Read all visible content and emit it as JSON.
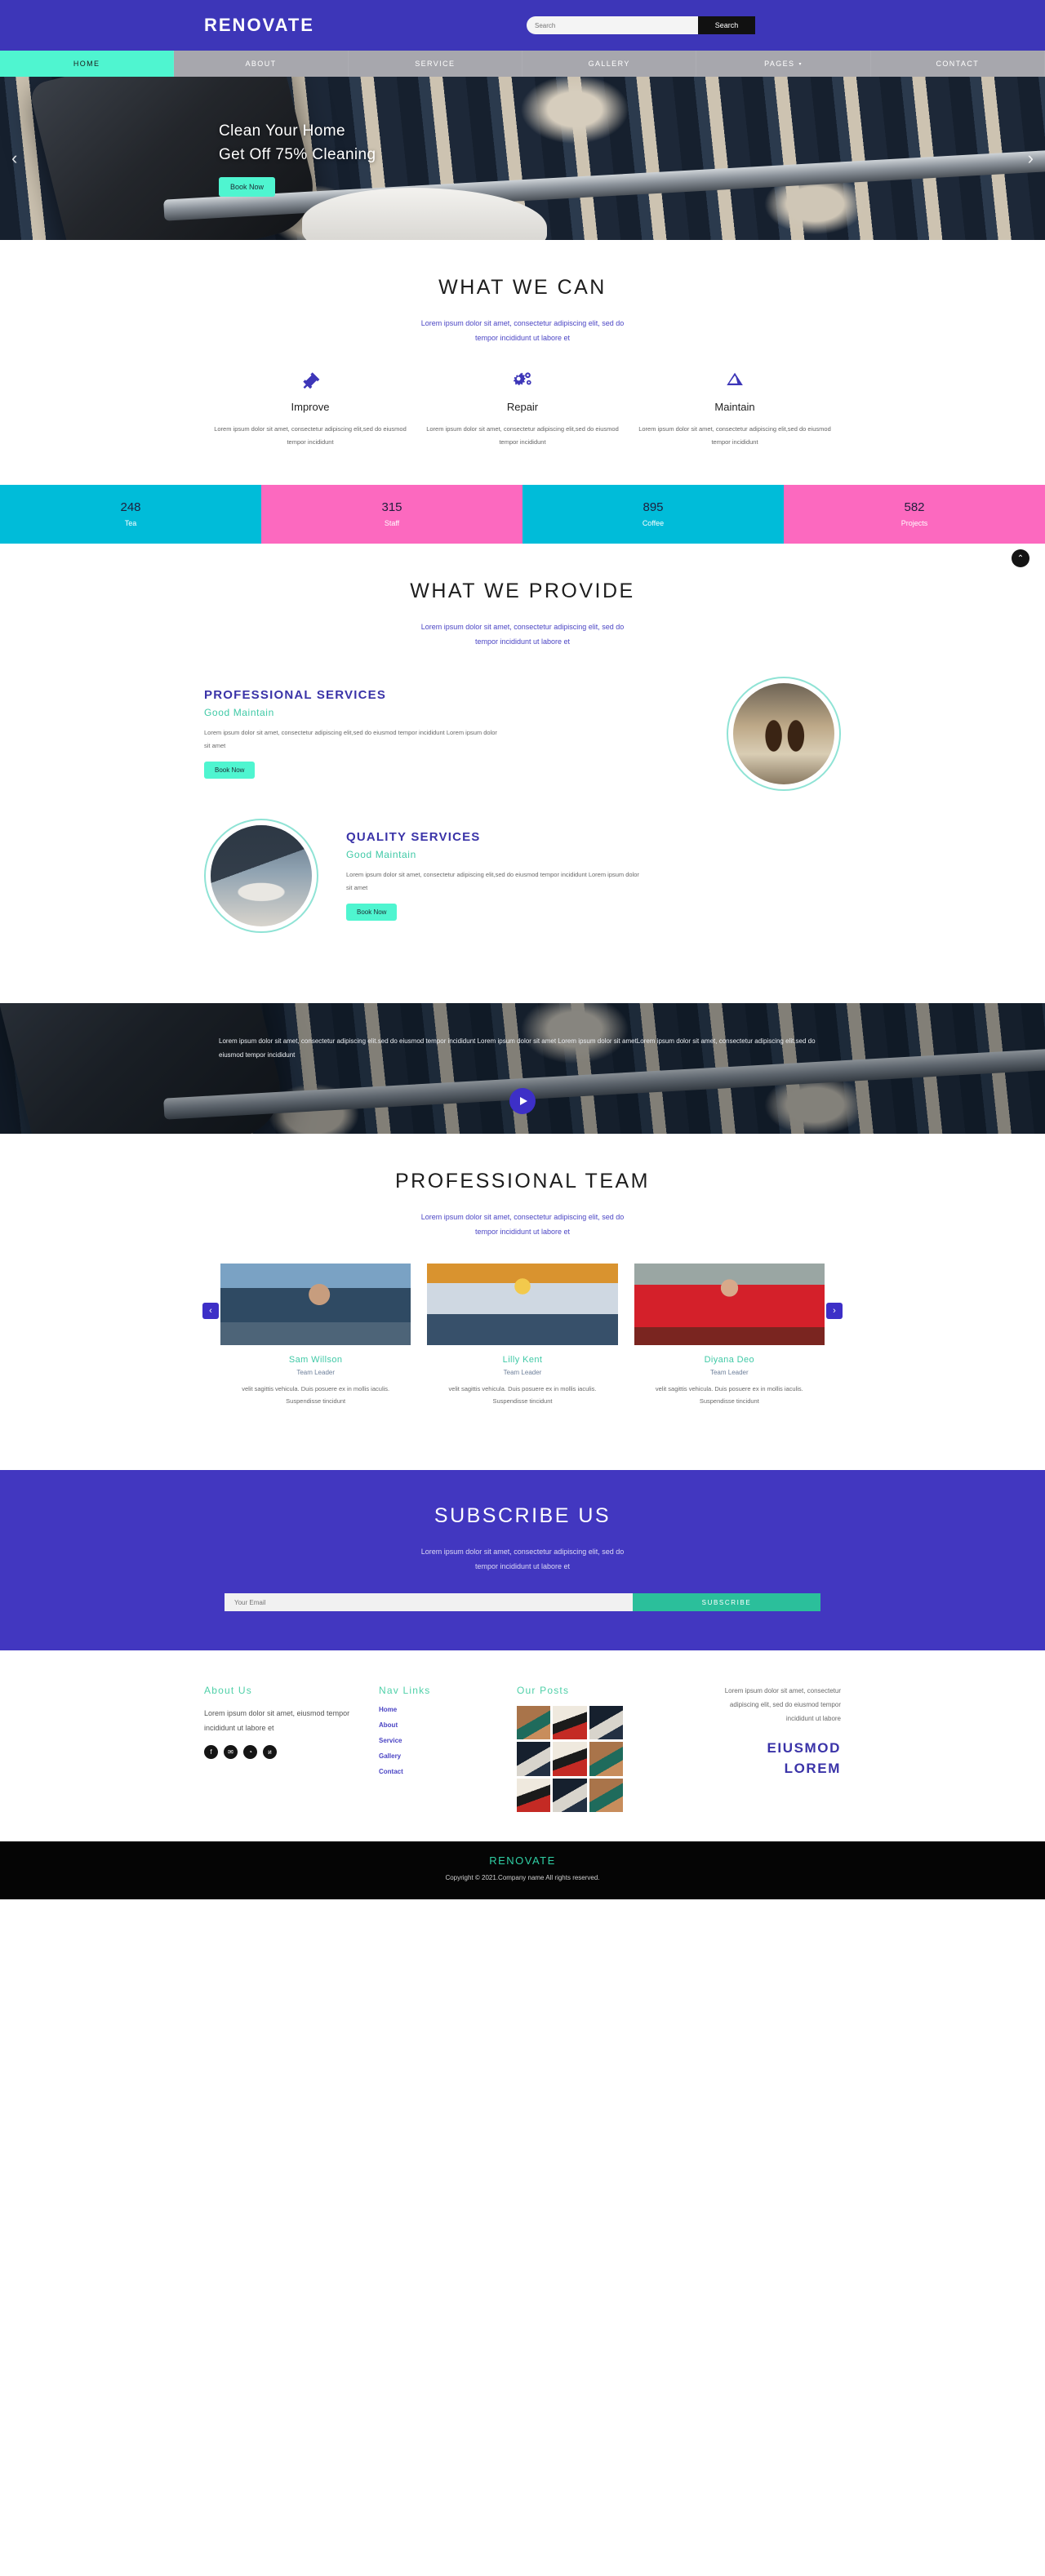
{
  "site": {
    "brand": "RENOVATE",
    "accent_purple": "#3d36b8",
    "accent_teal": "#4ff5d0",
    "accent_cyan": "#00bcd9",
    "accent_pink": "#fc69bf",
    "accent_green": "#3fc9a6"
  },
  "header": {
    "brand": "RENOVATE",
    "search": {
      "placeholder": "Search",
      "value": "",
      "button_label": "Search"
    }
  },
  "nav": {
    "items": [
      {
        "label": "HOME",
        "active": true,
        "has_dropdown": false
      },
      {
        "label": "ABOUT",
        "active": false,
        "has_dropdown": false
      },
      {
        "label": "SERVICE",
        "active": false,
        "has_dropdown": false
      },
      {
        "label": "GALLERY",
        "active": false,
        "has_dropdown": false
      },
      {
        "label": "PAGES",
        "active": false,
        "has_dropdown": true
      },
      {
        "label": "CONTACT",
        "active": false,
        "has_dropdown": false
      }
    ],
    "dropdown_caret": "▾"
  },
  "hero": {
    "line1": "Clean Your Home",
    "line2": "Get Off 75% Cleaning",
    "button_label": "Book Now",
    "prev_arrow": "‹",
    "next_arrow": "›"
  },
  "what_we_can": {
    "title": "WHAT WE CAN",
    "subtitle_line1": "Lorem ipsum dolor sit amet, consectetur adipiscing elit, sed do",
    "subtitle_line2": "tempor incididunt ut labore et",
    "features": [
      {
        "icon": "hammer-icon",
        "title": "Improve",
        "desc": "Lorem ipsum dolor sit amet, consectetur adipiscing elit,sed do eiusmod tempor incididunt"
      },
      {
        "icon": "gears-icon",
        "title": "Repair",
        "desc": "Lorem ipsum dolor sit amet, consectetur adipiscing elit,sed do eiusmod tempor incididunt"
      },
      {
        "icon": "ruler-icon",
        "title": "Maintain",
        "desc": "Lorem ipsum dolor sit amet, consectetur adipiscing elit,sed do eiusmod tempor incididunt"
      }
    ]
  },
  "stats": [
    {
      "number": "248",
      "label": "Tea",
      "color": "cyan"
    },
    {
      "number": "315",
      "label": "Staff",
      "color": "pink"
    },
    {
      "number": "895",
      "label": "Coffee",
      "color": "cyan"
    },
    {
      "number": "582",
      "label": "Projects",
      "color": "pink"
    }
  ],
  "what_we_provide": {
    "title": "WHAT WE PROVIDE",
    "subtitle_line1": "Lorem ipsum dolor sit amet, consectetur adipiscing elit, sed do",
    "subtitle_line2": "tempor incididunt ut labore et",
    "blocks": [
      {
        "heading": "PROFESSIONAL SERVICES",
        "subheading": "Good Maintain",
        "body": "Lorem ipsum dolor sit amet, consectetur adipiscing elit,sed do eiusmod tempor incididunt Lorem ipsum dolor sit amet",
        "button_label": "Book Now",
        "image": "spray-bottles-photo"
      },
      {
        "heading": "QUALITY SERVICES",
        "subheading": "Good Maintain",
        "body": "Lorem ipsum dolor sit amet, consectetur adipiscing elit,sed do eiusmod tempor incididunt Lorem ipsum dolor sit amet",
        "button_label": "Book Now",
        "image": "ironing-photo"
      }
    ]
  },
  "video_band": {
    "text": "Lorem ipsum dolor sit amet, consectetur adipiscing elit.sed do eiusmod tempor incididunt Lorem ipsum dolor sit amet Lorem ipsum dolor sit ametLorem ipsum dolor sit amet, consectetur adipiscing elit.sed do eiusmod tempor incididunt",
    "play_label": "play-button"
  },
  "team": {
    "title": "PROFESSIONAL TEAM",
    "subtitle_line1": "Lorem ipsum dolor sit amet, consectetur adipiscing elit, sed do",
    "subtitle_line2": "tempor incididunt ut labore et",
    "prev_arrow": "‹",
    "next_arrow": "›",
    "members": [
      {
        "name": "Sam Willson",
        "role": "Team Leader",
        "desc": "velit sagittis vehicula. Duis posuere ex in mollis iaculis. Suspendisse tincidunt"
      },
      {
        "name": "Lilly Kent",
        "role": "Team Leader",
        "desc": "velit sagittis vehicula. Duis posuere ex in mollis iaculis. Suspendisse tincidunt"
      },
      {
        "name": "Diyana Deo",
        "role": "Team Leader",
        "desc": "velit sagittis vehicula. Duis posuere ex in mollis iaculis. Suspendisse tincidunt"
      }
    ]
  },
  "subscribe": {
    "title": "SUBSCRIBE US",
    "subtitle_line1": "Lorem ipsum dolor sit amet, consectetur adipiscing elit, sed do",
    "subtitle_line2": "tempor incididunt ut labore et",
    "email_placeholder": "Your Email",
    "email_value": "",
    "button_label": "SUBSCRIBE"
  },
  "footer": {
    "about": {
      "title": "About Us",
      "body": "Lorem ipsum dolor sit amet, eiusmod tempor incididunt ut labore et",
      "socials": [
        {
          "icon": "facebook-icon",
          "glyph": "f"
        },
        {
          "icon": "email-icon",
          "glyph": "✉"
        },
        {
          "icon": "rss-icon",
          "glyph": "◔"
        },
        {
          "icon": "vk-icon",
          "glyph": "и"
        }
      ]
    },
    "nav": {
      "title": "Nav Links",
      "links": [
        "Home",
        "About",
        "Service",
        "Gallery",
        "Contact"
      ]
    },
    "posts": {
      "title": "Our Posts",
      "thumbs": [
        "mop-photo",
        "paint-roller-photo",
        "carpet-photo",
        "carpet-photo",
        "paint-roller-photo",
        "mop-photo",
        "paint-roller-photo",
        "carpet-photo",
        "mop-photo"
      ]
    },
    "right": {
      "body": "Lorem ipsum dolor sit amet, consectetur adipiscing elit, sed do eiusmod tempor incididunt ut labore",
      "heading_line1": "EIUSMOD",
      "heading_line2": "LOREM"
    }
  },
  "bottom_bar": {
    "brand": "RENOVATE",
    "copyright": "Copyright © 2021.Company name All rights reserved."
  },
  "scroll_top": {
    "glyph": "⌃"
  }
}
